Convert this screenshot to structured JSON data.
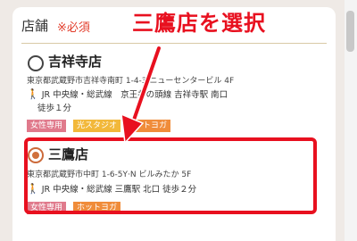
{
  "section": {
    "title": "店舗",
    "required": "※必須"
  },
  "annotation": {
    "text": "三鷹店を選択"
  },
  "stores": [
    {
      "name": "吉祥寺店",
      "selected": false,
      "address": "東京都武蔵野市吉祥寺南町 1-4-3 ニューセンタービル 4F",
      "access_line1": "JR 中央線・総武線　京王井の頭線 吉祥寺駅 南口",
      "access_line2": "徒歩１分",
      "tags": [
        "女性専用",
        "光スタジオ",
        "ホットヨガ"
      ]
    },
    {
      "name": "三鷹店",
      "selected": true,
      "address": "東京都武蔵野市中町 1-6-5Y·N ビルみたか 5F",
      "access_line1": "JR 中央線・総武線 三鷹駅 北口 徒歩２分",
      "tags": [
        "女性専用",
        "ホットヨガ"
      ]
    }
  ],
  "colors": {
    "accent_red": "#e8101f",
    "tag_pink": "#e07a8c",
    "tag_orange": "#f08c3a",
    "tag_yellow": "#f2b83a",
    "radio_selected": "#d0703c"
  },
  "icons": {
    "walk": "walking-person-icon"
  }
}
